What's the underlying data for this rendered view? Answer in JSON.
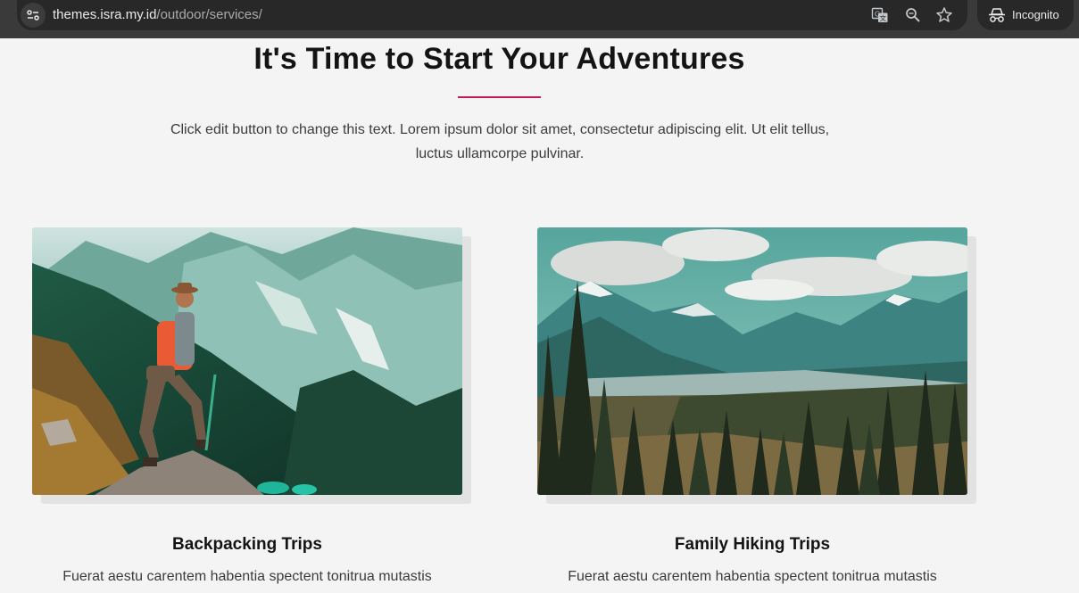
{
  "browser": {
    "url_host": "themes.isra.my.id",
    "url_path": "/outdoor/services/",
    "incognito_label": "Incognito",
    "icons": [
      "site-info-icon",
      "translate-icon",
      "zoom-icon",
      "bookmark-star-icon",
      "incognito-icon"
    ]
  },
  "section": {
    "title": "It's Time to Start Your Adventures",
    "intro": "Click edit button to change this text. Lorem ipsum dolor sit amet, consectetur adipiscing elit. Ut elit tellus, luctus ullamcorpe pulvinar.",
    "accent_color": "#c8195a"
  },
  "cards": [
    {
      "title": "Backpacking Trips",
      "text": "Fuerat aestu carentem habentia spectent tonitrua mutastis",
      "image": "hiker-on-mountain-photo"
    },
    {
      "title": "Family Hiking Trips",
      "text": "Fuerat aestu carentem habentia spectent tonitrua mutastis",
      "image": "mountain-valley-photo"
    }
  ]
}
